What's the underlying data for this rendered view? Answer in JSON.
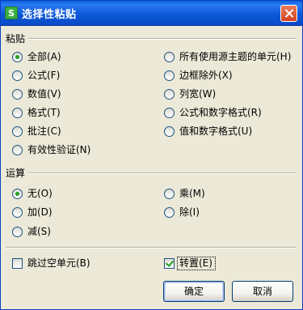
{
  "window": {
    "app_icon_letter": "S",
    "title": "选择性粘贴"
  },
  "paste_group": {
    "label": "粘贴",
    "options_left": [
      {
        "label": "全部(A)",
        "checked": true
      },
      {
        "label": "公式(F)",
        "checked": false
      },
      {
        "label": "数值(V)",
        "checked": false
      },
      {
        "label": "格式(T)",
        "checked": false
      },
      {
        "label": "批注(C)",
        "checked": false
      },
      {
        "label": "有效性验证(N)",
        "checked": false
      }
    ],
    "options_right": [
      {
        "label": "所有使用源主题的单元(H)",
        "checked": false
      },
      {
        "label": "边框除外(X)",
        "checked": false
      },
      {
        "label": "列宽(W)",
        "checked": false
      },
      {
        "label": "公式和数字格式(R)",
        "checked": false
      },
      {
        "label": "值和数字格式(U)",
        "checked": false
      }
    ]
  },
  "operation_group": {
    "label": "运算",
    "options_left": [
      {
        "label": "无(O)",
        "checked": true
      },
      {
        "label": "加(D)",
        "checked": false
      },
      {
        "label": "减(S)",
        "checked": false
      }
    ],
    "options_right": [
      {
        "label": "乘(M)",
        "checked": false
      },
      {
        "label": "除(I)",
        "checked": false
      }
    ]
  },
  "checkboxes": {
    "skip_blanks": {
      "label": "跳过空单元(B)",
      "checked": false
    },
    "transpose": {
      "label": "转置(E)",
      "checked": true
    }
  },
  "buttons": {
    "ok": "确定",
    "cancel": "取消"
  }
}
